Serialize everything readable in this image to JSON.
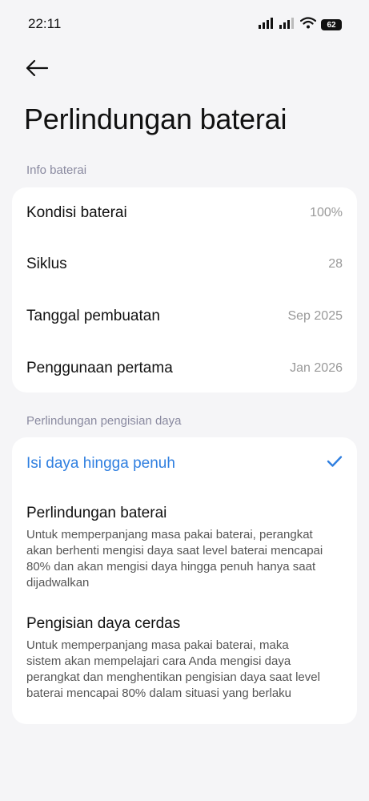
{
  "status_bar": {
    "time": "22:11",
    "battery_level": "62",
    "icons": [
      "signal-icon",
      "signal-icon",
      "wifi-icon",
      "battery-icon"
    ]
  },
  "header": {
    "back_icon": "arrow-left-icon",
    "title": "Perlindungan baterai"
  },
  "info_section": {
    "label": "Info baterai",
    "rows": [
      {
        "label": "Kondisi baterai",
        "value": "100%"
      },
      {
        "label": "Siklus",
        "value": "28"
      },
      {
        "label": "Tanggal pembuatan",
        "value": "Sep 2025"
      },
      {
        "label": "Penggunaan pertama",
        "value": "Jan 2026"
      }
    ]
  },
  "charging_section": {
    "label": "Perlindungan pengisian daya",
    "options": [
      {
        "title": "Isi daya hingga penuh",
        "description": "",
        "selected": true
      },
      {
        "title": "Perlindungan baterai",
        "description": "Untuk memperpanjang masa pakai baterai, perangkat akan berhenti mengisi daya saat level baterai mencapai 80% dan akan mengisi daya hingga penuh hanya saat dijadwalkan",
        "selected": false
      },
      {
        "title": "Pengisian daya cerdas",
        "description": "Untuk memperpanjang masa pakai baterai, maka sistem akan mempelajari cara Anda mengisi daya perangkat dan menghentikan pengisian daya saat level baterai mencapai 80% dalam situasi yang berlaku",
        "selected": false
      }
    ]
  },
  "colors": {
    "accent": "#2f7fe0",
    "background": "#f5f5f7",
    "card": "#ffffff",
    "section_label": "#8a8aa0"
  }
}
